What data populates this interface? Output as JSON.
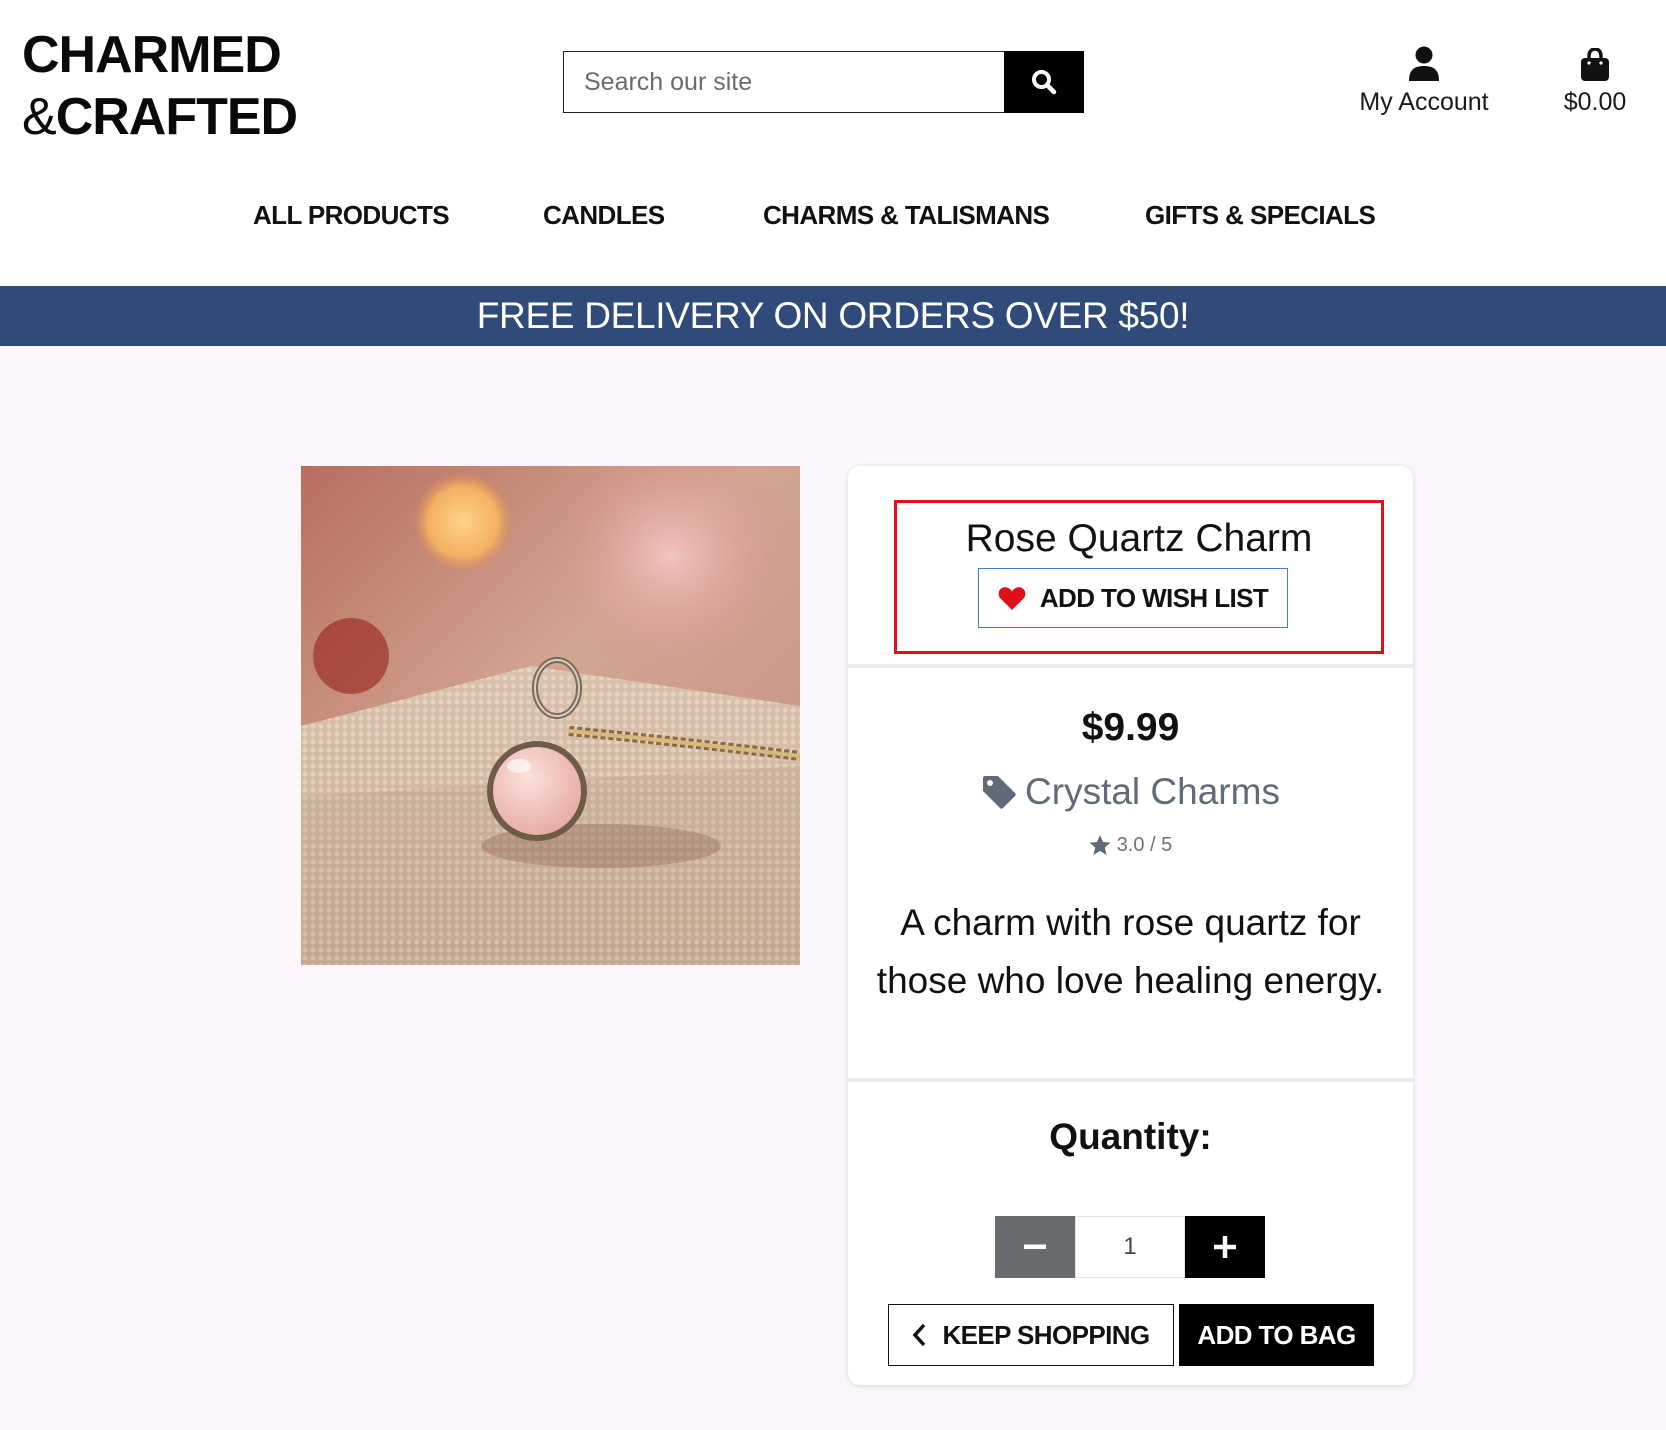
{
  "header": {
    "logo_line1": "CHARMED",
    "logo_amp": "&",
    "logo_line2": "CRAFTED",
    "search": {
      "placeholder": "Search our site",
      "value": "",
      "icon": "search-icon"
    },
    "account_label": "My Account",
    "account_icon": "user-icon",
    "cart_total": "$0.00",
    "cart_icon": "shopping-bag-icon"
  },
  "nav": {
    "items": [
      {
        "label": "ALL PRODUCTS"
      },
      {
        "label": "CANDLES"
      },
      {
        "label": "CHARMS & TALISMANS"
      },
      {
        "label": "GIFTS & SPECIALS"
      }
    ]
  },
  "promo_banner": "FREE DELIVERY ON ORDERS OVER $50!",
  "product": {
    "name": "Rose Quartz Charm",
    "wish_list_label": "ADD TO WISH LIST",
    "wish_icon": "heart-icon",
    "price": "$9.99",
    "category": "Crystal Charms",
    "category_icon": "tag-icon",
    "rating": "3.0 / 5",
    "rating_icon": "star-icon",
    "description": "A charm with rose quartz for those who love healing energy.",
    "quantity_label": "Quantity:",
    "quantity_value": "1",
    "keep_shopping_label": "KEEP SHOPPING",
    "add_to_bag_label": "ADD TO BAG"
  },
  "colors": {
    "promo_bg": "#304a79",
    "page_bg": "#fcf5fc",
    "highlight_border": "#e0101a",
    "heart": "#e0101a",
    "wish_border": "#3f7fd1",
    "minus_bg": "#686c70"
  }
}
